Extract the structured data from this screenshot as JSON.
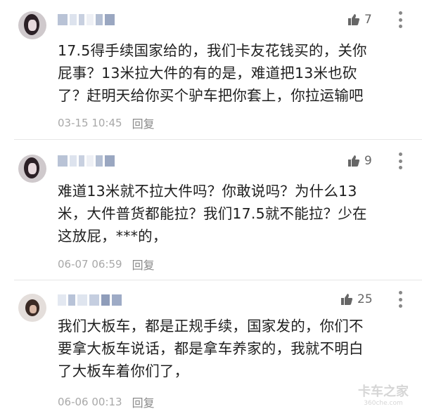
{
  "comments": [
    {
      "likes": "7",
      "lines": [
        "17.5得手续国家给的，我们卡友花钱买的，关你",
        "屁事？13米拉大件的有的是，难道把13米也砍",
        "了？赶明天给你买个驴车把你套上，你拉运输吧"
      ],
      "timestamp": "03-15 10:45",
      "reply_label": "回复"
    },
    {
      "likes": "9",
      "lines": [
        "难道13米就不拉大件吗？你敢说吗？为什么13",
        "米，大件普货都能拉？我们17.5就不能拉？少在",
        "这放屁，***的，"
      ],
      "timestamp": "06-07 06:59",
      "reply_label": "回复"
    },
    {
      "likes": "25",
      "lines": [
        "我们大板车，都是正规手续，国家发的，你们不",
        "要拿大板车说话，都是拿车养家的，我就不明白",
        "了大板车着你们了，"
      ],
      "timestamp": "06-06 00:13",
      "reply_label": "回复"
    }
  ],
  "watermark": {
    "main": "卡车之家",
    "sub": "360che.com"
  },
  "colors": {
    "text": "#1f1f1f",
    "meta": "#a8a8a8",
    "icon": "#666666",
    "divider": "#e6e6e6"
  },
  "icons": {
    "like": "thumbs-up-icon",
    "more": "vertical-dots-icon"
  }
}
